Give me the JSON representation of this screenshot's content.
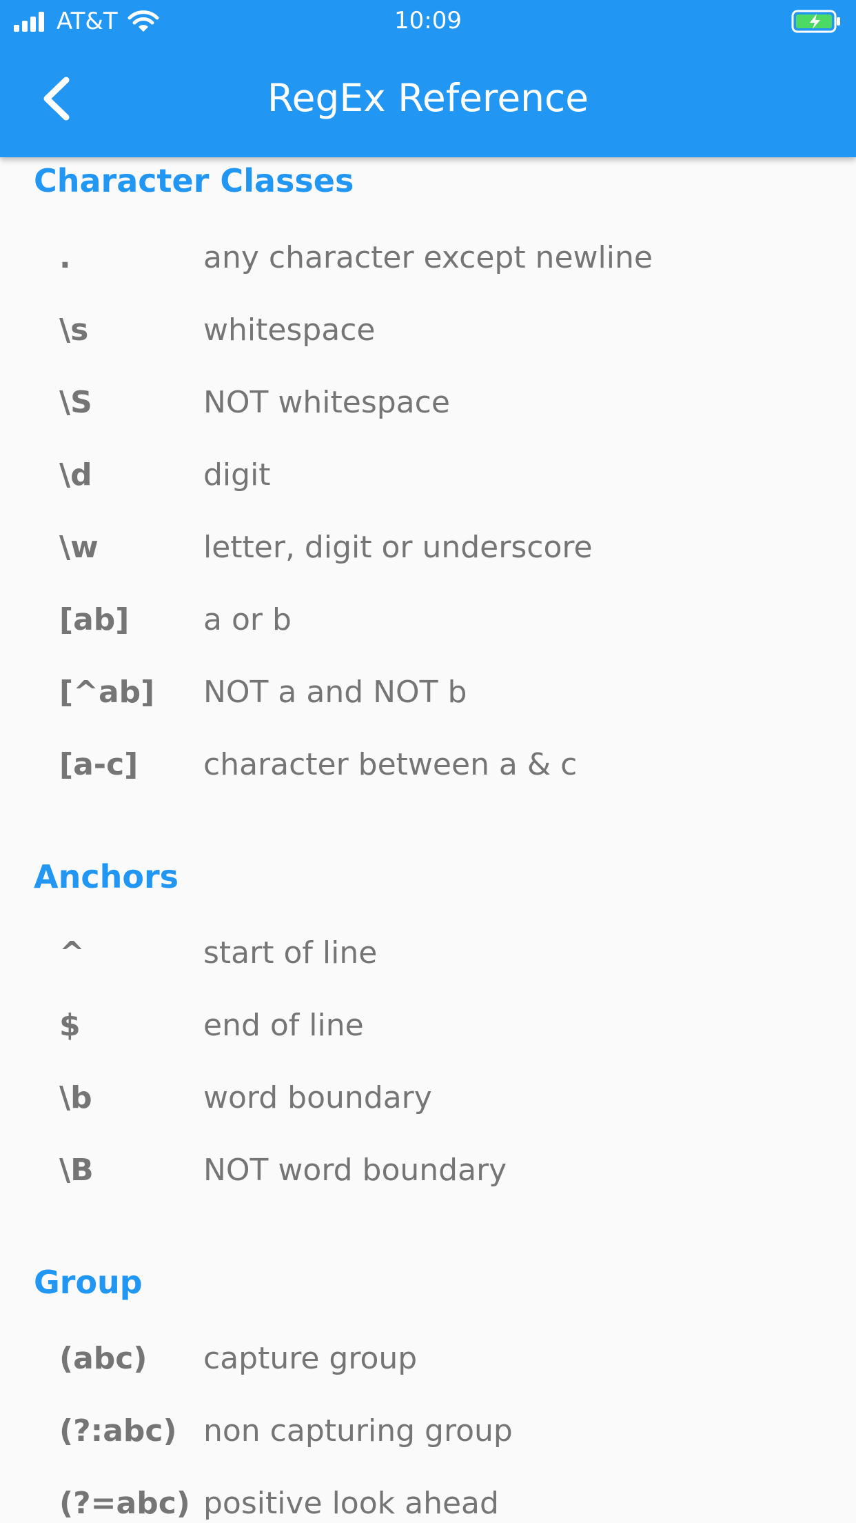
{
  "status_bar": {
    "carrier": "AT&T",
    "time": "10:09"
  },
  "app_bar": {
    "title": "RegEx Reference"
  },
  "colors": {
    "primary": "#2196f3",
    "text": "#757575",
    "background": "#fafafa"
  },
  "sections": [
    {
      "title": "Character Classes",
      "items": [
        {
          "symbol": ".",
          "description": "any character except newline"
        },
        {
          "symbol": "\\s",
          "description": "whitespace"
        },
        {
          "symbol": "\\S",
          "description": "NOT whitespace"
        },
        {
          "symbol": "\\d",
          "description": "digit"
        },
        {
          "symbol": "\\w",
          "description": "letter, digit or underscore"
        },
        {
          "symbol": "[ab]",
          "description": "a or b"
        },
        {
          "symbol": "[^ab]",
          "description": "NOT a and NOT b"
        },
        {
          "symbol": "[a-c]",
          "description": "character between a & c"
        }
      ]
    },
    {
      "title": "Anchors",
      "items": [
        {
          "symbol": "^",
          "description": "start of line"
        },
        {
          "symbol": "$",
          "description": "end of line"
        },
        {
          "symbol": "\\b",
          "description": "word boundary"
        },
        {
          "symbol": "\\B",
          "description": "NOT word boundary"
        }
      ]
    },
    {
      "title": "Group",
      "items": [
        {
          "symbol": "(abc)",
          "description": "capture group"
        },
        {
          "symbol": "(?:abc)",
          "description": "non capturing group"
        },
        {
          "symbol": "(?=abc)",
          "description": "positive look ahead"
        }
      ]
    }
  ]
}
